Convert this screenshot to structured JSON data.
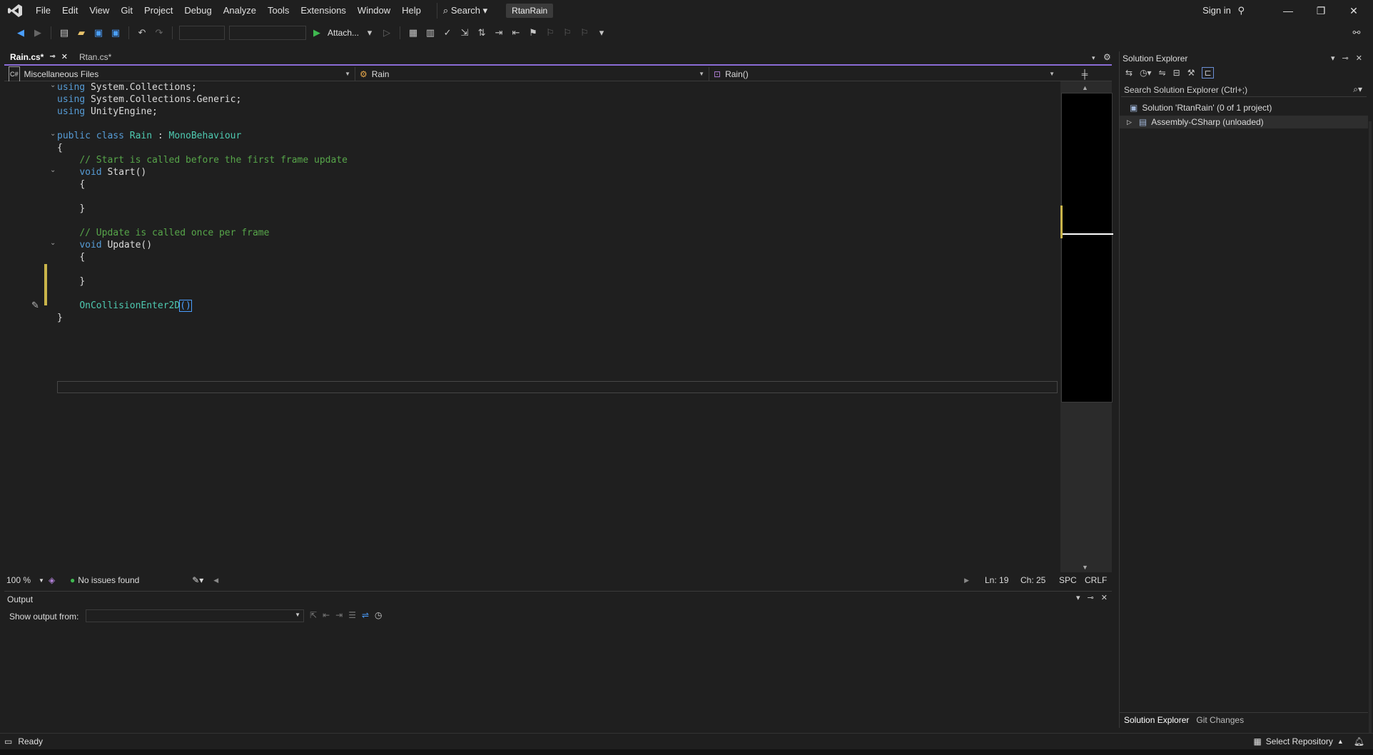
{
  "menu": [
    "File",
    "Edit",
    "View",
    "Git",
    "Project",
    "Debug",
    "Analyze",
    "Tools",
    "Extensions",
    "Window",
    "Help"
  ],
  "search_label": "Search",
  "solution_name": "RtanRain",
  "sign_in": "Sign in",
  "toolbar": {
    "attach_label": "Attach..."
  },
  "tabs": [
    {
      "label": "Rain.cs*",
      "active": true
    },
    {
      "label": "Rtan.cs*",
      "active": false
    }
  ],
  "navbar": {
    "project": "Miscellaneous Files",
    "type": "Rain",
    "member": "Rain()"
  },
  "code": {
    "l1": "System.Collections;",
    "l2": "System.Collections.Generic;",
    "l3": "UnityEngine;",
    "kw_using": "using",
    "class_decl_kw": "public class",
    "class_name": "Rain",
    "class_base_sep": ":",
    "class_base": "MonoBehaviour",
    "brace_open": "{",
    "brace_close": "}",
    "comment_start": "// Start is called before the first frame update",
    "kw_void": "void",
    "start_sig": "Start()",
    "comment_update": "// Update is called once per frame",
    "update_sig": "Update()",
    "collision": "OnCollisionEnter2D",
    "collision_parens": "()"
  },
  "editor_status": {
    "zoom": "100 %",
    "issues": "No issues found",
    "line": "Ln: 19",
    "col": "Ch: 25",
    "spacing": "SPC",
    "eol": "CRLF"
  },
  "output": {
    "title": "Output",
    "show_from": "Show output from:"
  },
  "solution_explorer": {
    "title": "Solution Explorer",
    "search_placeholder": "Search Solution Explorer (Ctrl+;)",
    "solution_node": "Solution 'RtanRain' (0 of 1 project)",
    "project_node": "Assembly-CSharp (unloaded)",
    "tab_sol": "Solution Explorer",
    "tab_git": "Git Changes"
  },
  "status": {
    "ready": "Ready",
    "repo": "Select Repository"
  },
  "colors": {
    "accent": "#8a6cd6",
    "keyword": "#569cd6",
    "comment": "#57a64a",
    "type": "#4ec9b0",
    "ok": "#3fb950"
  }
}
